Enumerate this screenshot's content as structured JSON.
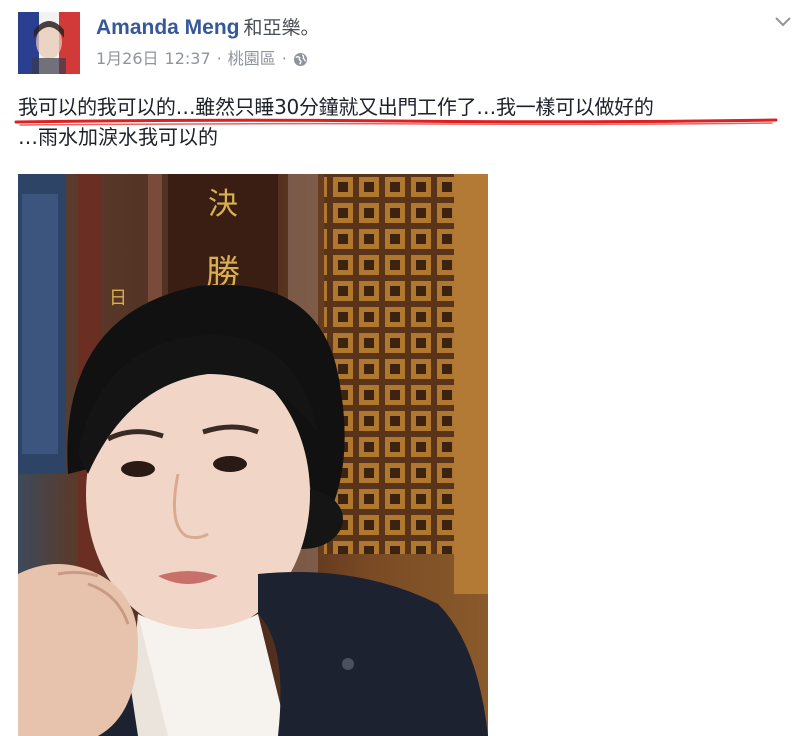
{
  "post": {
    "author_name": "Amanda Meng",
    "with_label": "和亞樂。",
    "date": "1月26日",
    "time": "12:37",
    "location": "桃園區",
    "separator": "·",
    "privacy_icon": "globe-icon",
    "menu_icon": "chevron-down-icon",
    "text_line_1": "我可以的我可以的…雖然只睡30分鐘就又出門工作了…我一樣可以做好的",
    "text_line_2": "…雨水加淚水我可以的",
    "underline_color": "#e02020",
    "link_color": "#365899"
  }
}
